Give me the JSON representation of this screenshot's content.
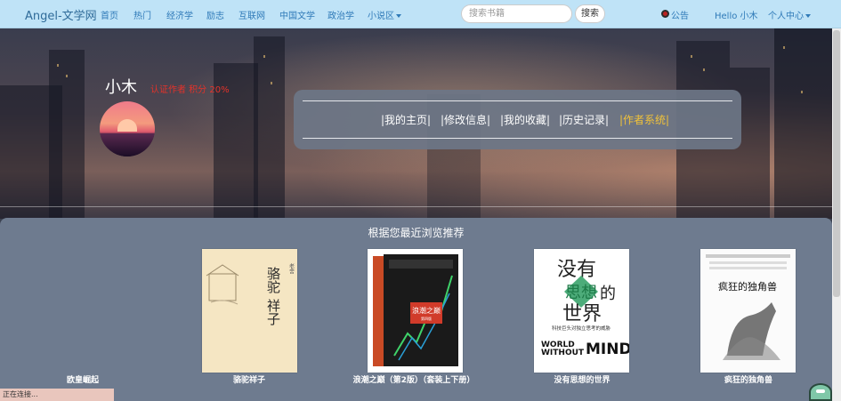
{
  "navbar": {
    "brand": "Angel-文学网",
    "links": [
      "首页",
      "热门",
      "经济学",
      "励志",
      "互联网",
      "中国文学",
      "政治学",
      "小说区"
    ],
    "search_placeholder": "搜索书籍",
    "search_button": "搜索",
    "notice": "公告",
    "greeting": "Hello 小木",
    "personal_center": "个人中心"
  },
  "profile": {
    "username": "小木",
    "author_tag": "认证作者 积分 20%",
    "nav": [
      "|我的主页|",
      "|修改信息|",
      "|我的收藏|",
      "|历史记录|",
      "|作者系统|"
    ],
    "active_nav": "|作者系统|"
  },
  "recommend": {
    "title": "根据您最近浏览推荐",
    "books": [
      {
        "name": "欧皇崛起",
        "cover": false
      },
      {
        "name": "骆驼祥子",
        "cover": true,
        "cover_text": "骆驼祥子",
        "cover_author": "老舍"
      },
      {
        "name": "浪潮之巅（第2版）（套装上下册）",
        "cover": true,
        "cover_text": "浪潮之巅",
        "cover_sub": "第四版"
      },
      {
        "name": "没有思想的世界",
        "cover": true,
        "cover_text": "没有思想的世界",
        "cover_sub": "科技巨头对独立思考的威胁",
        "cover_en1": "WORLD",
        "cover_en2": "WITHOUT",
        "cover_en3": "MIND"
      },
      {
        "name": "疯狂的独角兽",
        "cover": true,
        "cover_text": "疯狂的独角兽"
      }
    ]
  },
  "status_text": "正在连接...",
  "colors": {
    "navbar_bg": "#bfe3f7",
    "link": "#2f7ab8",
    "active_nav": "#f1c23a",
    "author_tag": "#e4322a",
    "panel": "#6e7b8f"
  }
}
